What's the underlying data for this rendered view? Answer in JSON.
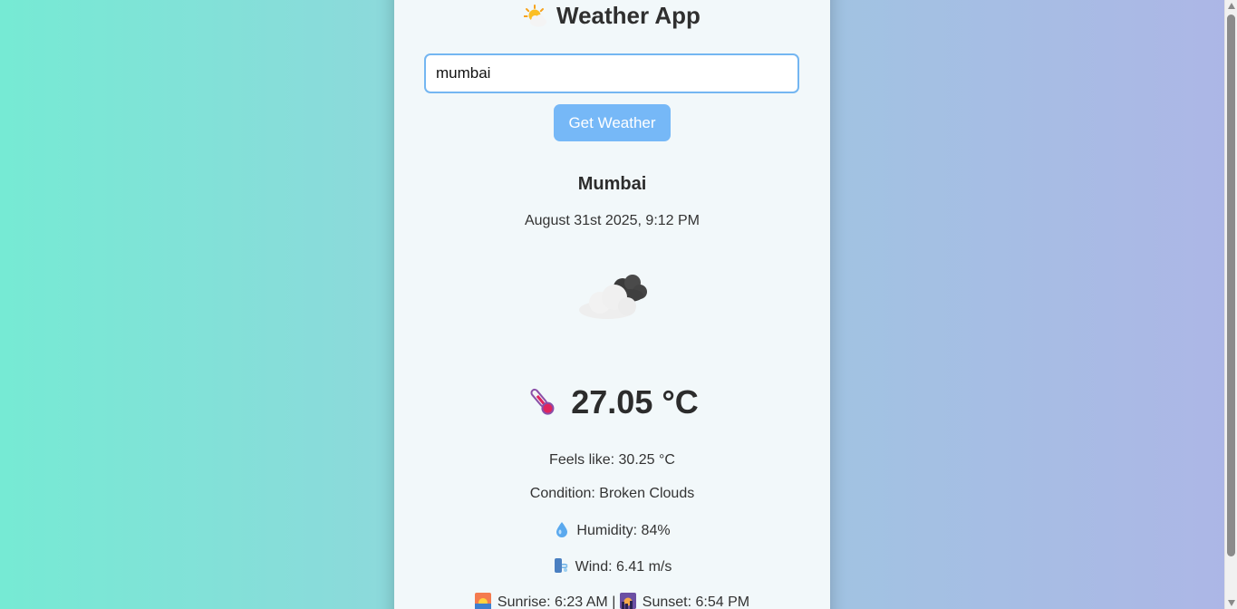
{
  "app": {
    "title": "Weather App",
    "title_icon": "sun-behind-cloud-icon"
  },
  "search": {
    "value": "mumbai",
    "button_label": "Get Weather"
  },
  "weather": {
    "city": "Mumbai",
    "datetime": "August 31st 2025, 9:12 PM",
    "icon": "broken-clouds-night-icon",
    "temperature": "27.05 °C",
    "feels_like": "Feels like: 30.25 °C",
    "condition": "Condition: Broken Clouds",
    "humidity": "Humidity: 84%",
    "wind": "Wind: 6.41 m/s",
    "sunrise": "Sunrise: 6:23 AM",
    "separator": "|",
    "sunset": "Sunset: 6:54 PM"
  },
  "colors": {
    "background_start": "#76ead4",
    "background_end": "#adb6e6",
    "card": "#f2f8fa",
    "accent": "#76b8f7",
    "input_border": "#74b6f1"
  }
}
